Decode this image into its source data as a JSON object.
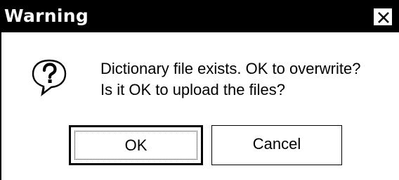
{
  "window": {
    "title": "Warning",
    "close_icon": "close-icon"
  },
  "dialog": {
    "icon": "question-icon",
    "message_line1": "Dictionary file exists. OK to overwrite?",
    "message_line2": "Is it OK to upload the files?"
  },
  "buttons": {
    "ok_label": "OK",
    "cancel_label": "Cancel"
  },
  "colors": {
    "titlebar_bg": "#000000",
    "title_text": "#ffffff",
    "dialog_bg": "#ffffff"
  }
}
